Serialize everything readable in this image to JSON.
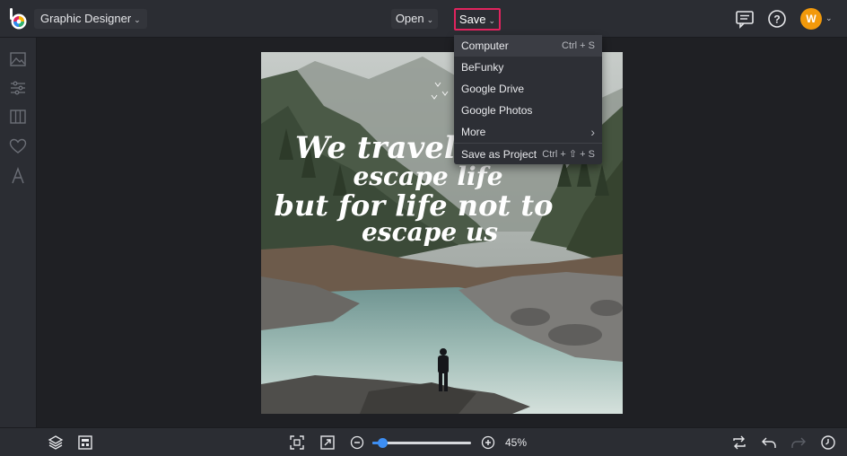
{
  "header": {
    "app_menu_label": "Graphic Designer",
    "open_label": "Open",
    "save_label": "Save",
    "avatar_initial": "W"
  },
  "save_menu": {
    "items": [
      {
        "label": "Computer",
        "shortcut": "Ctrl + S"
      },
      {
        "label": "BeFunky",
        "shortcut": ""
      },
      {
        "label": "Google Drive",
        "shortcut": ""
      },
      {
        "label": "Google Photos",
        "shortcut": ""
      },
      {
        "label": "More",
        "shortcut": "›"
      },
      {
        "label": "Save as Project",
        "shortcut": "Ctrl + ⇧ + S"
      }
    ]
  },
  "canvas": {
    "quote_lines": [
      "We travel not to",
      "escape life",
      "but for life not to",
      "escape us"
    ]
  },
  "footer": {
    "zoom": "45%",
    "zoom_fraction": 0.1
  },
  "colors": {
    "accent_save_border": "#e0245e",
    "avatar": "#f2990b",
    "slider": "#3d8ef3"
  }
}
